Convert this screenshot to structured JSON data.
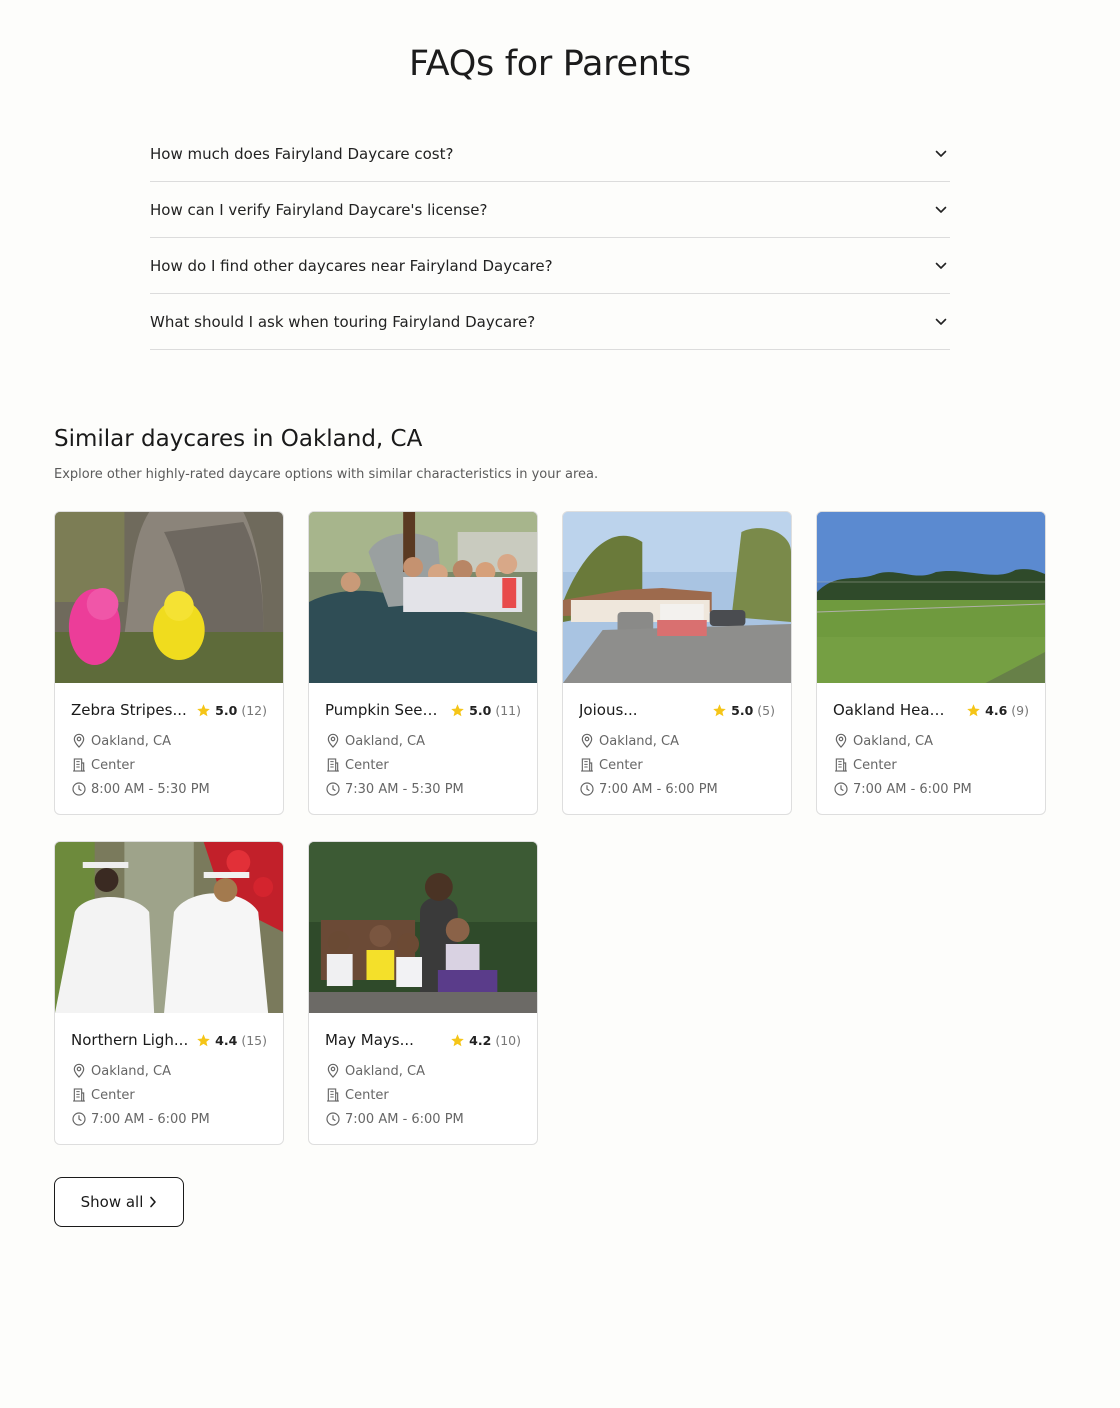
{
  "faq": {
    "title": "FAQs for Parents",
    "questions": [
      "How much does Fairyland Daycare cost?",
      "How can I verify Fairyland Daycare's license?",
      "How do I find other daycares near Fairyland Daycare?",
      "What should I ask when touring Fairyland Daycare?"
    ]
  },
  "similar": {
    "title": "Similar daycares in Oakland, CA",
    "subtitle": "Explore other highly-rated daycare options with similar characteristics in your area.",
    "cards": [
      {
        "name": "Zebra Stripes...",
        "rating": "5.0",
        "count": "(12)",
        "location": "Oakland, CA",
        "type": "Center",
        "hours": "8:00 AM - 5:30 PM",
        "photo": "children-playing-by-tree"
      },
      {
        "name": "Pumpkin Seed...",
        "rating": "5.0",
        "count": "(11)",
        "location": "Oakland, CA",
        "type": "Center",
        "hours": "7:30 AM - 5:30 PM",
        "photo": "kids-on-dinosaur-sculpture"
      },
      {
        "name": "Joious...",
        "rating": "5.0",
        "count": "(5)",
        "location": "Oakland, CA",
        "type": "Center",
        "hours": "7:00 AM - 6:00 PM",
        "photo": "house-street-view"
      },
      {
        "name": "Oakland Head...",
        "rating": "4.6",
        "count": "(9)",
        "location": "Oakland, CA",
        "type": "Center",
        "hours": "7:00 AM - 6:00 PM",
        "photo": "grass-field-with-fence"
      },
      {
        "name": "Northern Ligh...",
        "rating": "4.4",
        "count": "(15)",
        "location": "Oakland, CA",
        "type": "Center",
        "hours": "7:00 AM - 6:00 PM",
        "photo": "graduates-in-white-gowns"
      },
      {
        "name": "May Mays...",
        "rating": "4.2",
        "count": "(10)",
        "location": "Oakland, CA",
        "type": "Center",
        "hours": "7:00 AM - 6:00 PM",
        "photo": "children-on-bench"
      }
    ],
    "show_all_label": "Show all"
  },
  "colors": {
    "star": "#f5c518",
    "border": "#dedede",
    "text_muted": "#666666"
  }
}
